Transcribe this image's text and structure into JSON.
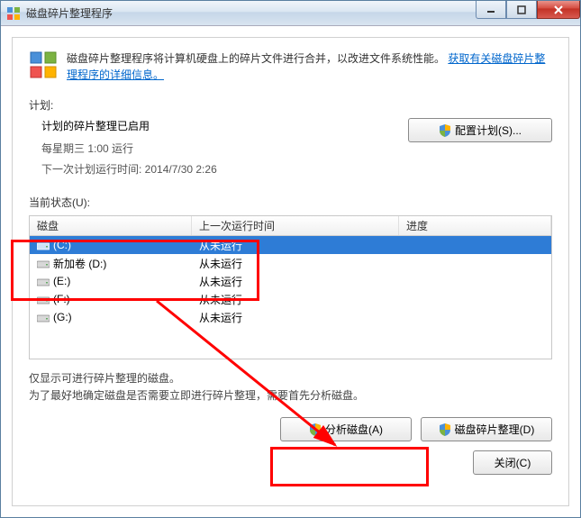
{
  "window": {
    "title": "磁盘碎片整理程序"
  },
  "intro": {
    "text_prefix": "磁盘碎片整理程序将计算机硬盘上的碎片文件进行合并，以改进文件系统性能。",
    "link_text": "获取有关磁盘碎片整理程序的详细信息。"
  },
  "schedule": {
    "section_label": "计划:",
    "heading": "计划的碎片整理已启用",
    "line1": "每星期三  1:00 运行",
    "line2": "下一次计划运行时间: 2014/7/30 2:26",
    "config_button": "配置计划(S)..."
  },
  "status": {
    "section_label": "当前状态(U):"
  },
  "table": {
    "headers": {
      "disk": "磁盘",
      "last_run": "上一次运行时间",
      "progress": "进度"
    },
    "rows": [
      {
        "name": "(C:)",
        "last_run": "从未运行",
        "selected": true,
        "type": "os"
      },
      {
        "name": "新加卷 (D:)",
        "last_run": "从未运行",
        "selected": false,
        "type": "hdd"
      },
      {
        "name": "(E:)",
        "last_run": "从未运行",
        "selected": false,
        "type": "hdd"
      },
      {
        "name": "(F:)",
        "last_run": "从未运行",
        "selected": false,
        "type": "hdd"
      },
      {
        "name": "(G:)",
        "last_run": "从未运行",
        "selected": false,
        "type": "hdd"
      }
    ]
  },
  "footer": {
    "line1": "仅显示可进行碎片整理的磁盘。",
    "line2": "为了最好地确定磁盘是否需要立即进行碎片整理，需要首先分析磁盘。"
  },
  "buttons": {
    "analyze": "分析磁盘(A)",
    "defrag": "磁盘碎片整理(D)",
    "close": "关闭(C)"
  }
}
